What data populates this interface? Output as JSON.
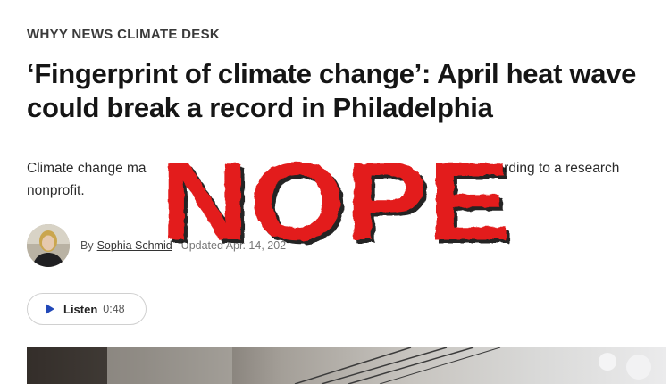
{
  "article": {
    "kicker": "WHYY NEWS CLIMATE DESK",
    "headline": "‘Fingerprint of climate change’: April heat wave could break a record in Philadelphia",
    "dek_start": "Climate change ma",
    "dek_end": "ording to a research",
    "dek_line2": "nonprofit."
  },
  "byline": {
    "prefix": "By",
    "author": "Sophia Schmid",
    "updated": "Updated Apr. 14, 202"
  },
  "audio": {
    "label": "Listen",
    "duration": "0:48",
    "accent": "#2148b8"
  },
  "overlay": {
    "stamp_text": "NOPE",
    "color": "#e31b1b"
  },
  "icons": {
    "play": "play-icon"
  }
}
